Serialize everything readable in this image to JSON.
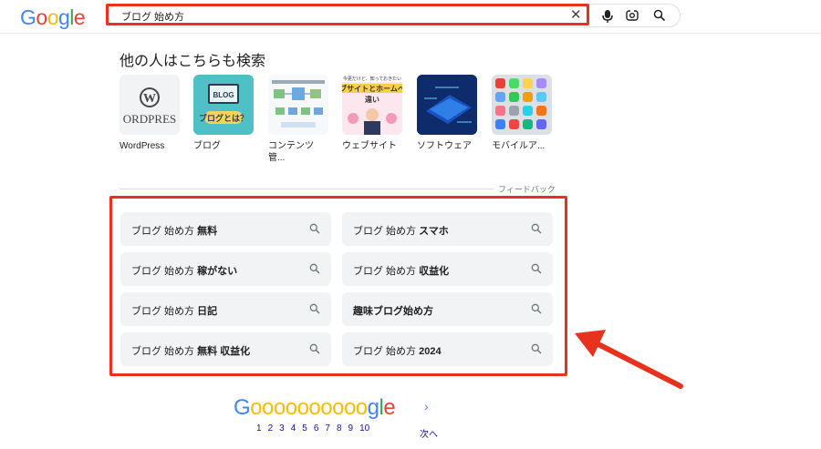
{
  "header": {
    "logo": [
      "G",
      "o",
      "o",
      "g",
      "l",
      "e"
    ],
    "logo_colors": [
      "#4285f4",
      "#ea4335",
      "#fbbc05",
      "#4285f4",
      "#34a853",
      "#ea4335"
    ],
    "query": "ブログ 始め方",
    "clear_icon": "✕"
  },
  "people_also_search": {
    "title": "他の人はこちらも検索",
    "items": [
      {
        "label": "WordPress",
        "thumb_text": "W\nORDPRES"
      },
      {
        "label": "ブログ",
        "thumb_text": "BLOG\nブログとは？"
      },
      {
        "label": "コンテンツ\n管...",
        "thumb_text": ""
      },
      {
        "label": "ウェブサイト",
        "thumb_text": "今更だけど、知っておきたい\nブサイトとホームペ\n違い"
      },
      {
        "label": "ソフトウェア",
        "thumb_text": ""
      },
      {
        "label": "モバイルア...",
        "thumb_text": ""
      }
    ],
    "feedback": "フィードバック"
  },
  "related_searches": [
    {
      "prefix": "ブログ 始め方 ",
      "bold": "無料"
    },
    {
      "prefix": "ブログ 始め方 ",
      "bold": "スマホ"
    },
    {
      "prefix": "ブログ 始め方 ",
      "bold": "稼がない"
    },
    {
      "prefix": "ブログ 始め方 ",
      "bold": "収益化"
    },
    {
      "prefix": "ブログ 始め方 ",
      "bold": "日記"
    },
    {
      "prefix": "",
      "bold": "趣味ブログ始め方"
    },
    {
      "prefix": "ブログ 始め方 ",
      "bold": "無料 収益化"
    },
    {
      "prefix": "ブログ 始め方 ",
      "bold": "2024"
    }
  ],
  "pagination": {
    "logo_G": "G",
    "logo_os": "oooooooooo",
    "logo_gle": [
      "g",
      "l",
      "e"
    ],
    "pages": [
      "1",
      "2",
      "3",
      "4",
      "5",
      "6",
      "7",
      "8",
      "9",
      "10"
    ],
    "current": "1",
    "next_label": "次へ",
    "next_chevron": "›"
  }
}
